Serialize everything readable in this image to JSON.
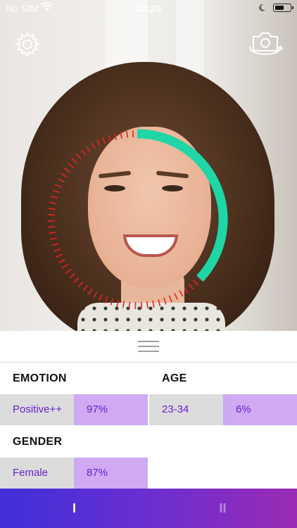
{
  "status_bar": {
    "carrier": "No SIM",
    "time": "20:20",
    "battery_level": 0.6
  },
  "camera": {
    "settings_icon": "gear-icon",
    "switch_camera_icon": "camera-switch-icon",
    "gauge": {
      "positive_fraction": 0.37,
      "positive_color": "#1ed6a6",
      "negative_color": "#e02525"
    }
  },
  "results": {
    "emotion": {
      "title": "EMOTION",
      "label": "Positive++",
      "value": "97%"
    },
    "age": {
      "title": "AGE",
      "label": "23-34",
      "value": "6%"
    },
    "gender": {
      "title": "GENDER",
      "label": "Female",
      "value": "87%"
    }
  },
  "bottom_bar": {
    "tabs": [
      {
        "label": "I",
        "active": true
      },
      {
        "label": "II",
        "active": false
      }
    ]
  },
  "colors": {
    "accent_purple": "#6a21c9",
    "value_cell": "#cfa9f2",
    "label_cell": "#dcdcdc"
  }
}
